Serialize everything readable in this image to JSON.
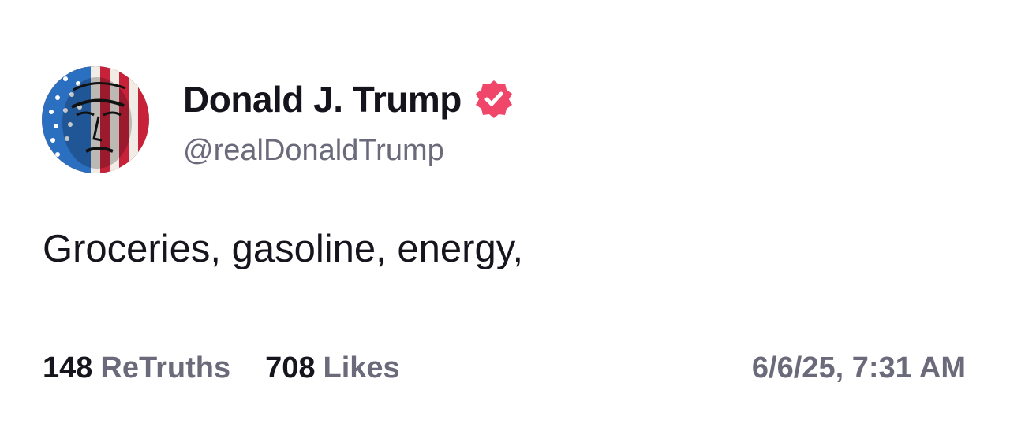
{
  "author": {
    "display_name": "Donald J. Trump",
    "handle": "@realDonaldTrump",
    "avatar_icon": "flag-portrait-avatar",
    "verified_icon": "verified-badge-icon",
    "verified_color": "#f0466a"
  },
  "post": {
    "text": "Groceries, gasoline, energy,"
  },
  "stats": {
    "retruths_count": "148",
    "retruths_label": "ReTruths",
    "likes_count": "708",
    "likes_label": "Likes",
    "timestamp": "6/6/25, 7:31 AM"
  }
}
